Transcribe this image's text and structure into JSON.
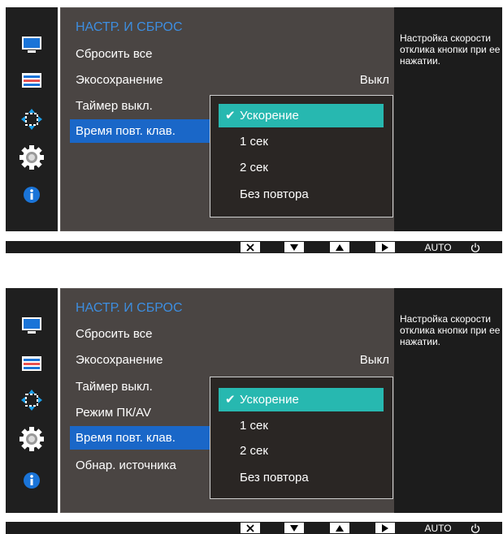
{
  "help_text": "Настройка скорости отклика кнопки при ее нажатии.",
  "screens": [
    {
      "title": "НАСТР. И СБРОС",
      "items": [
        "Сбросить все",
        "Экосохранение",
        "Таймер выкл.",
        "Время повт. клав."
      ],
      "eco_value": "Выкл",
      "submenu": [
        "Ускорение",
        "1 сек",
        "2 сек",
        "Без повтора"
      ]
    },
    {
      "title": "НАСТР. И СБРОС",
      "items": [
        "Сбросить все",
        "Экосохранение",
        "Таймер выкл.",
        "Режим ПК/AV",
        "Время повт. клав.",
        "Обнар. источника"
      ],
      "eco_value": "Выкл",
      "submenu": [
        "Ускорение",
        "1 сек",
        "2 сек",
        "Без повтора"
      ]
    }
  ],
  "bottom_bar": {
    "auto_label": "AUTO"
  },
  "icons": [
    "monitor-icon",
    "picture-settings-icon",
    "move-position-icon",
    "gear-icon",
    "info-icon"
  ],
  "colors": {
    "accent": "#3d8ee0",
    "selected_item": "#1a67c8",
    "selected_option": "#27b8b0"
  }
}
